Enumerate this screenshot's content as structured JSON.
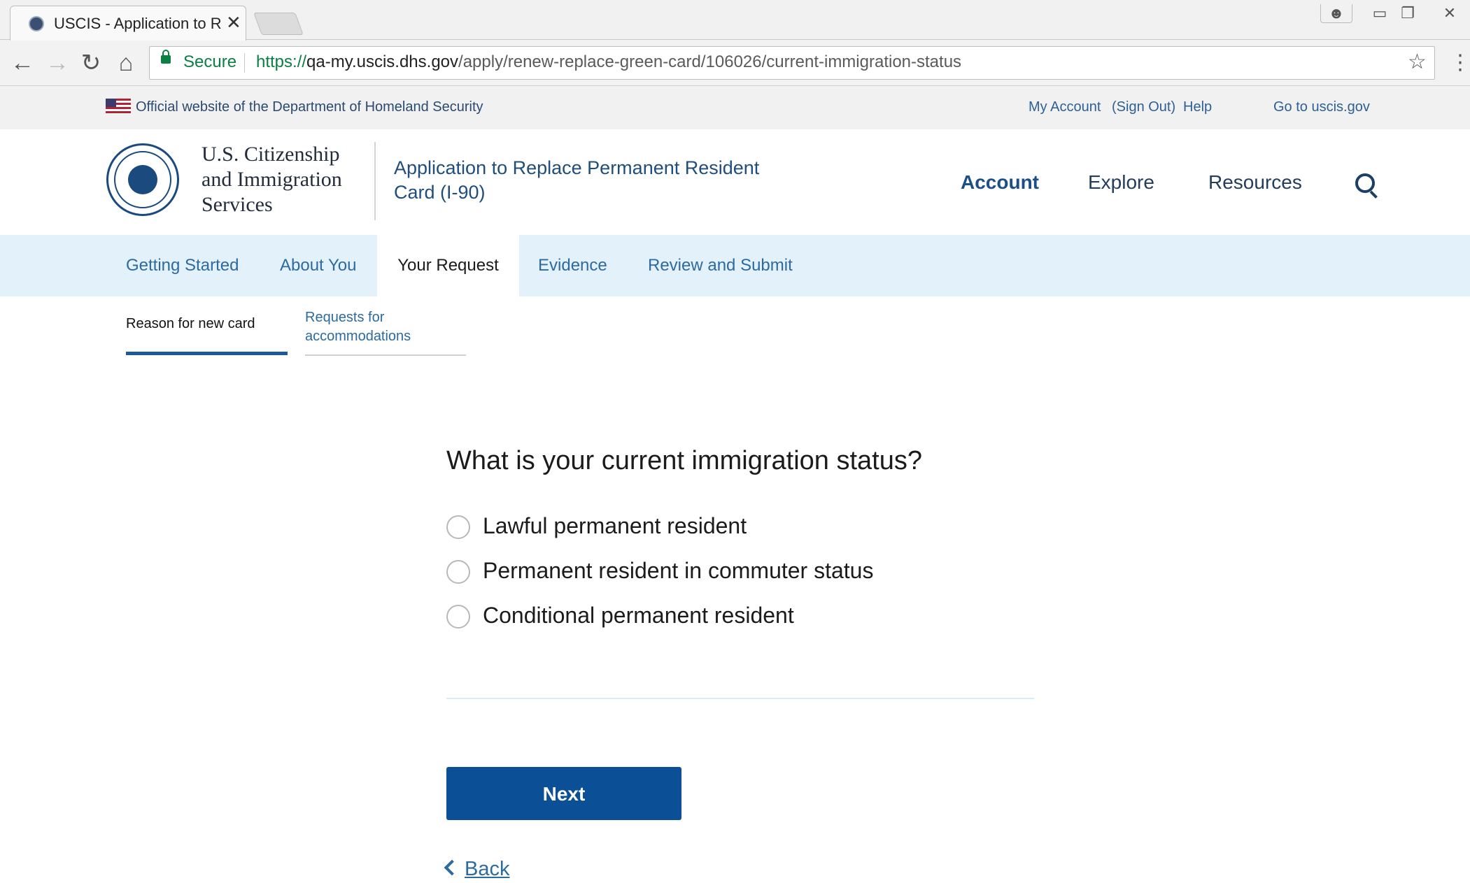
{
  "browser": {
    "tab_title": "USCIS - Application to Re",
    "close_glyph": "✕",
    "secure_label": "Secure",
    "url_scheme": "https://",
    "url_host": "qa-my.uscis.dhs.gov",
    "url_path": "/apply/renew-replace-green-card/106026/current-immigration-status"
  },
  "gov_banner": {
    "text": "Official website of the Department of Homeland Security",
    "links": {
      "my_account": "My Account",
      "sign_out": "(Sign Out)",
      "help": "Help",
      "go_to_uscis": "Go to uscis.gov"
    }
  },
  "header": {
    "agency_line1": "U.S. Citizenship",
    "agency_line2": "and Immigration",
    "agency_line3": "Services",
    "app_title_line1": "Application to Replace Permanent Resident",
    "app_title_line2": "Card (I-90)",
    "nav": {
      "account": "Account",
      "explore": "Explore",
      "resources": "Resources"
    }
  },
  "steps": {
    "getting_started": "Getting Started",
    "about_you": "About You",
    "your_request": "Your Request",
    "evidence": "Evidence",
    "review_submit": "Review and Submit"
  },
  "substeps": {
    "reason": "Reason for new card",
    "accommodations_line1": "Requests for",
    "accommodations_line2": "accommodations"
  },
  "form": {
    "question": "What is your current immigration status?",
    "options": [
      "Lawful permanent resident",
      "Permanent resident in commuter status",
      "Conditional permanent resident"
    ],
    "next_label": "Next",
    "back_label": "Back"
  }
}
